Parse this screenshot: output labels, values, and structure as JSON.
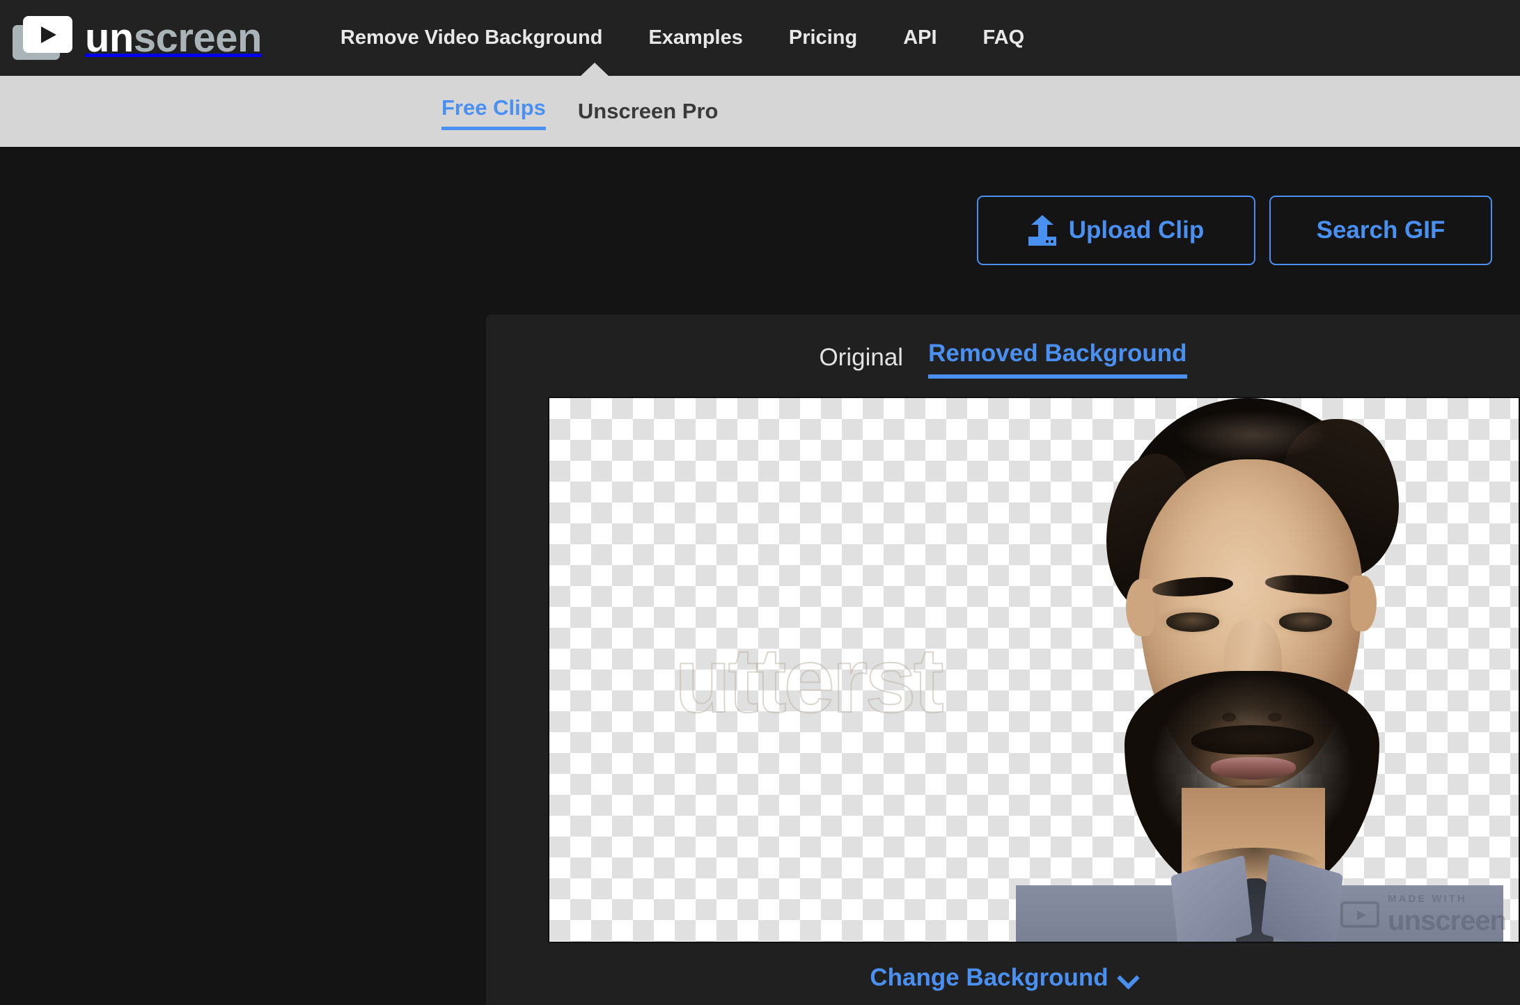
{
  "brand": {
    "name_part1": "un",
    "name_part2": "screen",
    "logo_icon": "video-play-icon"
  },
  "header": {
    "nav": [
      {
        "label": "Remove Video Background"
      },
      {
        "label": "Examples"
      },
      {
        "label": "Pricing"
      },
      {
        "label": "API"
      },
      {
        "label": "FAQ"
      }
    ],
    "background": "#222222"
  },
  "subnav": {
    "items": [
      {
        "label": "Free Clips",
        "active": true
      },
      {
        "label": "Unscreen Pro",
        "active": false
      }
    ],
    "background": "#d6d6d6",
    "active_color": "#4a90f0",
    "inactive_color": "#3a3a3a"
  },
  "actions": {
    "upload_label": "Upload Clip",
    "upload_icon": "upload-icon",
    "search_label": "Search GIF",
    "accent_color": "#4a90f0"
  },
  "preview": {
    "tabs": [
      {
        "label": "Original",
        "active": false
      },
      {
        "label": "Removed Background",
        "active": true
      }
    ],
    "canvas": {
      "transparency_pattern": "checkerboard",
      "checker_light": "#ffffff",
      "checker_dark": "#e0e0e0",
      "stock_watermark": "utterst",
      "made_with_label": "MADE WITH",
      "made_with_brand": "unscreen"
    },
    "change_background_label": "Change Background",
    "chevron_icon": "chevron-down-icon"
  },
  "colors": {
    "page_background": "#141414",
    "panel_background": "#202020",
    "accent": "#4a90f0"
  }
}
